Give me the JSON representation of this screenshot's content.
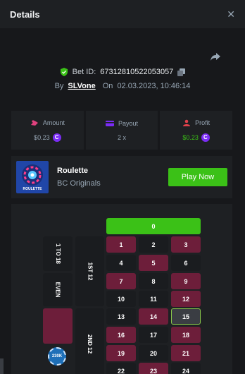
{
  "header": {
    "title": "Details",
    "close_symbol": "✕"
  },
  "bet": {
    "id_label": "Bet ID:",
    "id_value": "67312810522053057",
    "by_label": "By",
    "user": "SLVone",
    "on_label": "On",
    "datetime": "02.03.2023, 10:46:14"
  },
  "stats": {
    "amount_label": "Amount",
    "amount_value": "$0.23",
    "payout_label": "Payout",
    "payout_value": "2 x",
    "profit_label": "Profit",
    "profit_value": "$0.23",
    "coin_symbol": "C"
  },
  "game": {
    "name": "Roulette",
    "provider": "BC Originals",
    "thumb_label": "ROULETTE",
    "play_label": "Play Now"
  },
  "board": {
    "zero": "0",
    "numbers": [
      "1",
      "2",
      "3",
      "4",
      "5",
      "6",
      "7",
      "8",
      "9",
      "10",
      "11",
      "12",
      "13",
      "14",
      "15",
      "16",
      "17",
      "18",
      "19",
      "20",
      "21",
      "22",
      "23",
      "24"
    ],
    "red_numbers": [
      1,
      3,
      5,
      7,
      9,
      12,
      14,
      16,
      18,
      19,
      21,
      23
    ],
    "highlighted": 15,
    "left_labels": [
      "1 TO 18",
      "EVEN"
    ],
    "dozen_labels": [
      "1ST 12",
      "2ND 12"
    ],
    "chip_value": "230K"
  },
  "colors": {
    "accent": "#3bc117",
    "red": "#6d1e3a",
    "black": "#1a1c1f",
    "coin": "#7b2cf5"
  }
}
